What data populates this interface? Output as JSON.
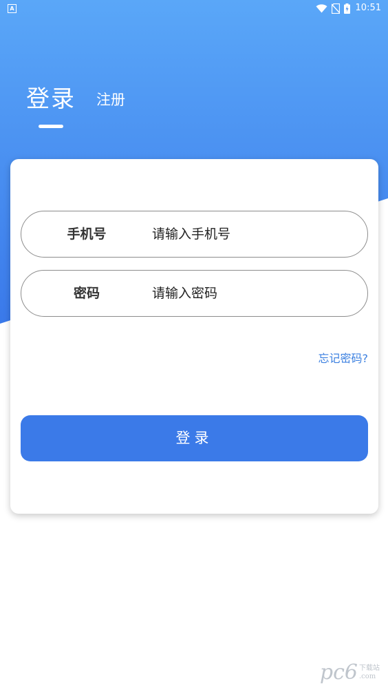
{
  "status_bar": {
    "app_icon_letter": "A",
    "time": "10:51"
  },
  "tabs": {
    "login": "登录",
    "register": "注册"
  },
  "form": {
    "phone_label": "手机号",
    "phone_placeholder": "请输入手机号",
    "password_label": "密码",
    "password_placeholder": "请输入密码",
    "forgot_password": "忘记密码?",
    "submit_label": "登录"
  },
  "watermark": {
    "main": "pc6",
    "side_top": "下载站",
    "side_bottom": ".com"
  },
  "colors": {
    "header_gradient_top": "#5aa7f8",
    "header_gradient_bottom": "#3b7ae8",
    "button": "#3b7ae8",
    "link": "#3a7fe0"
  }
}
